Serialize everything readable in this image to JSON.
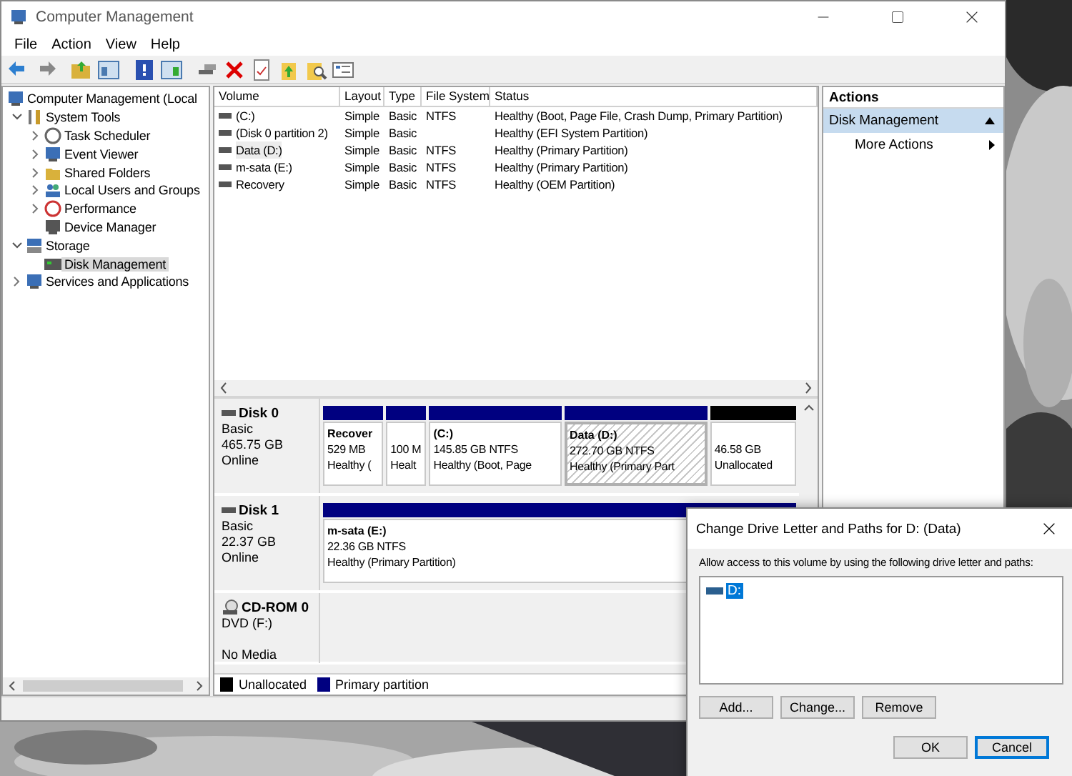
{
  "window": {
    "title": "Computer Management"
  },
  "menu": [
    "File",
    "Action",
    "View",
    "Help"
  ],
  "tree": [
    {
      "label": "Computer Management (Local",
      "kind": "root",
      "selected": false,
      "children": [
        {
          "label": "System Tools",
          "kind": "node",
          "expanded": true,
          "selected": false,
          "children": [
            {
              "label": "Task Scheduler",
              "kind": "node",
              "expanded": false,
              "selected": false
            },
            {
              "label": "Event Viewer",
              "kind": "node",
              "expanded": false,
              "selected": false
            },
            {
              "label": "Shared Folders",
              "kind": "node",
              "expanded": false,
              "selected": false
            },
            {
              "label": "Local Users and Groups",
              "kind": "node",
              "expanded": false,
              "selected": false
            },
            {
              "label": "Performance",
              "kind": "node",
              "expanded": false,
              "selected": false
            },
            {
              "label": "Device Manager",
              "kind": "leaf",
              "selected": false
            }
          ]
        },
        {
          "label": "Storage",
          "kind": "node",
          "expanded": true,
          "selected": false,
          "children": [
            {
              "label": "Disk Management",
              "kind": "leaf",
              "selected": true
            }
          ]
        },
        {
          "label": "Services and Applications",
          "kind": "node",
          "expanded": false,
          "selected": false
        }
      ]
    }
  ],
  "volumes": {
    "columns": [
      "Volume",
      "Layout",
      "Type",
      "File System",
      "Status"
    ],
    "rows": [
      {
        "cells": [
          "(C:)",
          "Simple",
          "Basic",
          "NTFS",
          "Healthy (Boot, Page File, Crash Dump, Primary Partition)"
        ],
        "selected": false
      },
      {
        "cells": [
          "(Disk 0 partition 2)",
          "Simple",
          "Basic",
          "",
          "Healthy (EFI System Partition)"
        ],
        "selected": false
      },
      {
        "cells": [
          "Data (D:)",
          "Simple",
          "Basic",
          "NTFS",
          "Healthy (Primary Partition)"
        ],
        "selected": true
      },
      {
        "cells": [
          "m-sata (E:)",
          "Simple",
          "Basic",
          "NTFS",
          "Healthy (Primary Partition)"
        ],
        "selected": false
      },
      {
        "cells": [
          "Recovery",
          "Simple",
          "Basic",
          "NTFS",
          "Healthy (OEM Partition)"
        ],
        "selected": false
      }
    ]
  },
  "disks": [
    {
      "name": "Disk 0",
      "kind": "disk",
      "lines": [
        "Basic",
        "465.75 GB",
        "Online"
      ],
      "partitions": [
        {
          "name": "Recover",
          "size": "529 MB",
          "status": "Healthy (",
          "kind": "primary",
          "selected": false
        },
        {
          "size": "100 M",
          "status": "Healt",
          "kind": "primary",
          "selected": false
        },
        {
          "name": "(C:)",
          "size": "145.85 GB NTFS",
          "status": "Healthy (Boot, Page",
          "kind": "primary",
          "selected": false
        },
        {
          "name": "Data  (D:)",
          "size": "272.70 GB NTFS",
          "status": "Healthy (Primary Part",
          "kind": "primary",
          "selected": true
        },
        {
          "size": "46.58 GB",
          "status": "Unallocated",
          "kind": "unallocated",
          "selected": false
        }
      ]
    },
    {
      "name": "Disk 1",
      "kind": "disk",
      "lines": [
        "Basic",
        "22.37 GB",
        "Online"
      ],
      "partitions": [
        {
          "name": "m-sata  (E:)",
          "size": "22.36 GB NTFS",
          "status": "Healthy (Primary Partition)",
          "kind": "primary",
          "selected": false
        }
      ]
    },
    {
      "name": "CD-ROM 0",
      "kind": "cdrom",
      "lines": [
        "DVD (F:)",
        "No Media"
      ]
    }
  ],
  "legend": [
    {
      "label": "Unallocated",
      "color": "#000000"
    },
    {
      "label": "Primary partition",
      "color": "#000080"
    }
  ],
  "actions": {
    "title": "Actions",
    "section": {
      "label": "Disk Management",
      "expanded": true
    },
    "items": [
      "More Actions"
    ]
  },
  "dialog": {
    "title": "Change Drive Letter and Paths for D: (Data)",
    "prompt": "Allow access to this volume by using the following drive letter and paths:",
    "paths": [
      {
        "label": "D:",
        "selected": true
      }
    ],
    "buttons": [
      "Add...",
      "Change...",
      "Remove"
    ],
    "footer": [
      {
        "label": "OK",
        "default": false
      },
      {
        "label": "Cancel",
        "default": true
      }
    ]
  }
}
